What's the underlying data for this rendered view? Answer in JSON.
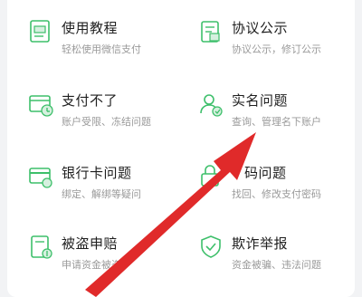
{
  "items": [
    {
      "title": "使用教程",
      "sub": "轻松使用微信支付",
      "icon": "tutorial-doc-icon"
    },
    {
      "title": "协议公示",
      "sub": "协议公示，修订公示",
      "icon": "agreement-doc-icon"
    },
    {
      "title": "支付不了",
      "sub": "账户受限、冻结问题",
      "icon": "payment-blocked-icon"
    },
    {
      "title": "实名问题",
      "sub": "查询、管理名下账户",
      "icon": "user-verify-icon"
    },
    {
      "title": "银行卡问题",
      "sub": "绑定、解绑等疑问",
      "icon": "bank-card-icon"
    },
    {
      "title": "码问题",
      "sub": "找回、修改支付密码",
      "icon": "password-icon"
    },
    {
      "title": "被盗申赔",
      "sub": "申请资金被盗",
      "icon": "theft-claim-icon"
    },
    {
      "title": "欺诈举报",
      "sub": "资金被骗、违法问题",
      "icon": "fraud-report-icon"
    }
  ],
  "colors": {
    "accent_green": "#3dbf6a",
    "arrow_red": "#e02a2a"
  }
}
